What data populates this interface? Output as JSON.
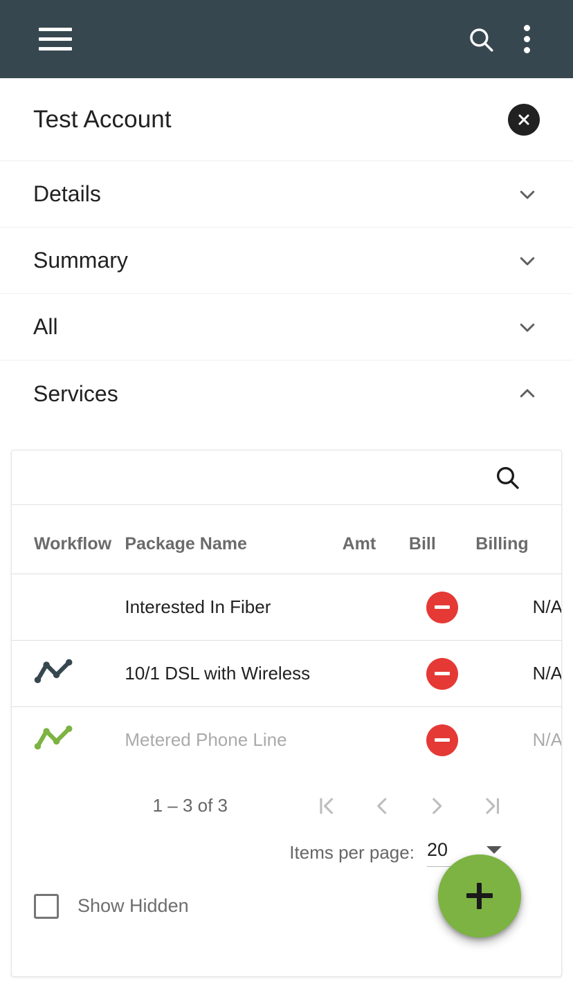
{
  "appbar": {
    "menu_icon": "hamburger-menu-icon",
    "search_icon": "search-icon",
    "overflow_icon": "more-vert-icon",
    "background": "#37474f"
  },
  "account": {
    "title": "Test Account",
    "close_icon": "close-circle-icon"
  },
  "panels": [
    {
      "label": "Details",
      "expanded": false,
      "chevron": "chevron-down-icon"
    },
    {
      "label": "Summary",
      "expanded": false,
      "chevron": "chevron-down-icon"
    },
    {
      "label": "All",
      "expanded": false,
      "chevron": "chevron-down-icon"
    },
    {
      "label": "Services",
      "expanded": true,
      "chevron": "chevron-up-icon"
    }
  ],
  "services": {
    "toolbar": {
      "search_icon": "search-icon"
    },
    "table": {
      "headers": [
        "Workflow",
        "Package Name",
        "Amt",
        "Bill",
        "Billing"
      ],
      "rows": [
        {
          "workflow_icon": "",
          "workflow_icon_color": "",
          "package_name": "Interested In Fiber",
          "amt": "",
          "bill_icon": "remove-circle-icon",
          "billing": "N/A",
          "hidden": false
        },
        {
          "workflow_icon": "timeline-icon",
          "workflow_icon_color": "#37474f",
          "package_name": "10/1 DSL with Wireless",
          "amt": "",
          "bill_icon": "remove-circle-icon",
          "billing": "N/A",
          "hidden": false
        },
        {
          "workflow_icon": "timeline-icon",
          "workflow_icon_color": "#7cb342",
          "package_name": "Metered Phone Line",
          "amt": "",
          "bill_icon": "remove-circle-icon",
          "billing": "N/A",
          "hidden": true
        }
      ]
    },
    "paginator": {
      "range_label": "1 – 3 of 3",
      "first_page_icon": "first-page-icon",
      "prev_page_icon": "chevron-left-icon",
      "next_page_icon": "chevron-right-icon",
      "last_page_icon": "last-page-icon",
      "items_per_page_label": "Items per page:",
      "items_per_page_value": "20",
      "items_per_page_options": [
        "20"
      ]
    },
    "show_hidden": {
      "label": "Show Hidden",
      "checked": false
    }
  },
  "fab": {
    "icon": "plus-icon",
    "color": "#7cb342"
  },
  "colors": {
    "appbar": "#37474f",
    "accent_green": "#7cb342",
    "danger_red": "#e53935",
    "text_primary": "#212121",
    "text_muted": "#aaaaaa"
  }
}
